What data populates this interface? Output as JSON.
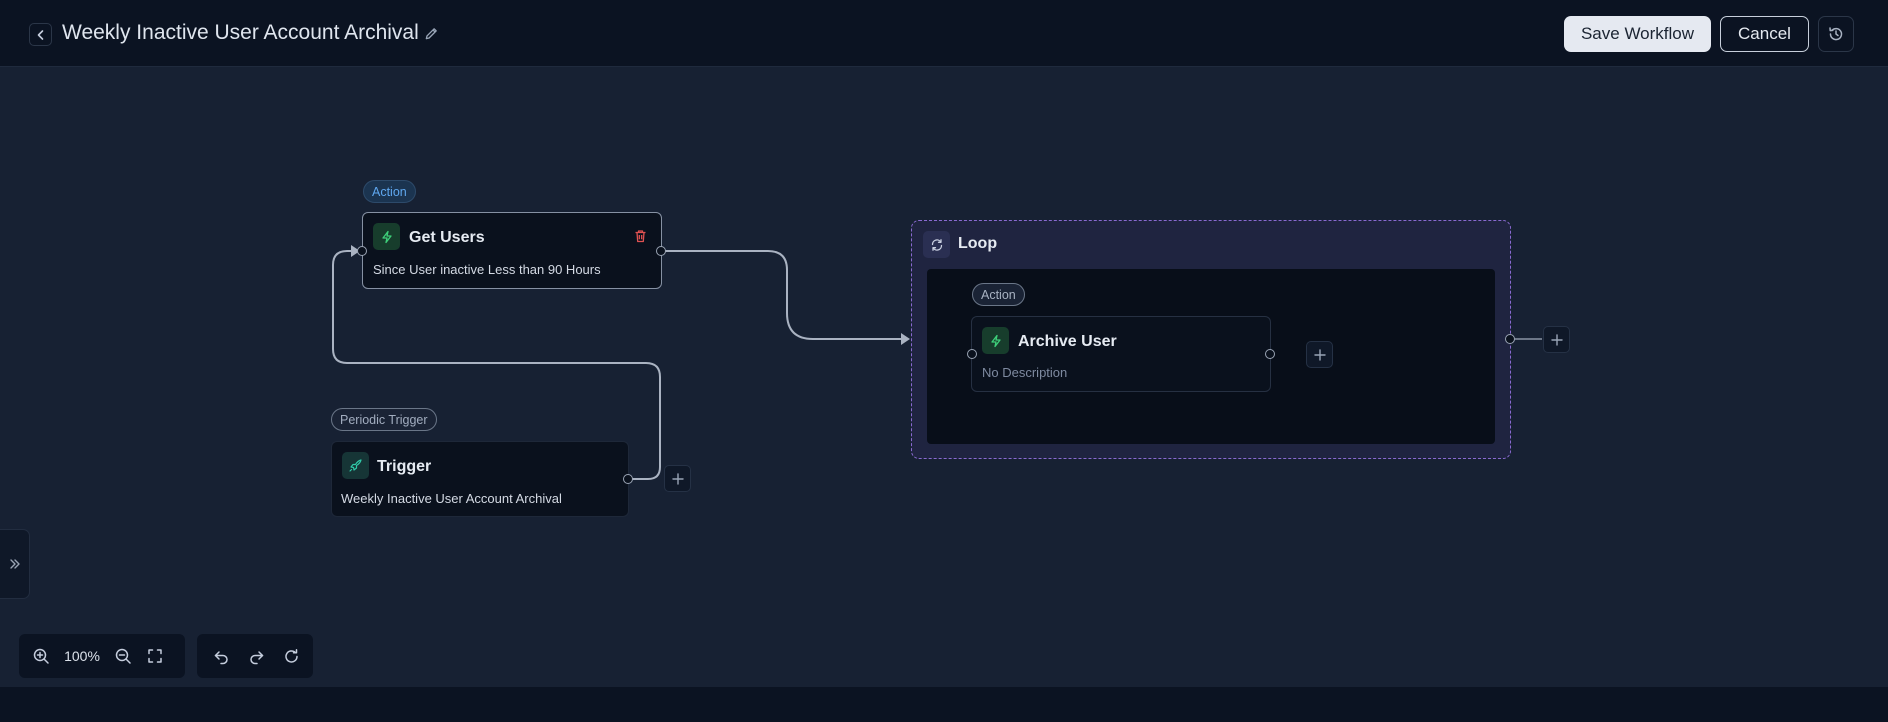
{
  "header": {
    "title": "Weekly Inactive User Account Archival",
    "save_label": "Save Workflow",
    "cancel_label": "Cancel"
  },
  "nodes": {
    "get_users": {
      "badge": "Action",
      "title": "Get Users",
      "description": "Since User inactive Less than 90 Hours"
    },
    "trigger": {
      "badge": "Periodic Trigger",
      "title": "Trigger",
      "description": "Weekly Inactive User Account Archival"
    },
    "loop": {
      "title": "Loop",
      "child": {
        "badge": "Action",
        "title": "Archive User",
        "description": "No Description"
      }
    }
  },
  "toolbar": {
    "zoom_level": "100%"
  },
  "icons": {
    "back": "chevron-left-icon",
    "edit": "pencil-icon",
    "history": "history-icon",
    "action": "lightning-icon",
    "trigger": "rocket-icon",
    "loop": "refresh-icon",
    "delete": "trash-icon",
    "add": "plus-icon",
    "sidebar": "double-chevron-right-icon"
  },
  "colors": {
    "canvas_bg": "#172133",
    "header_bg": "#0b1322",
    "action_badge": "#5fa7ef",
    "action_icon": "#3ed07a",
    "loop_border": "#8a6ad1",
    "delete": "#e05252"
  }
}
